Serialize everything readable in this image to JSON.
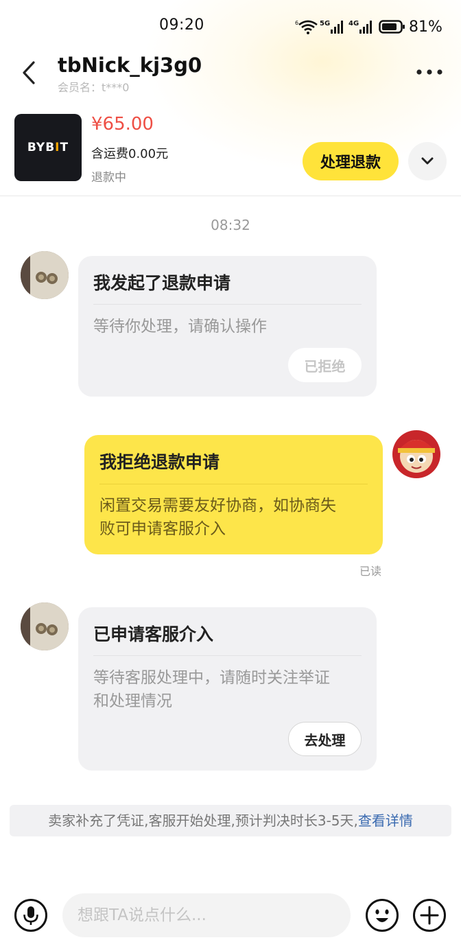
{
  "status_bar": {
    "time": "09:20",
    "battery": "81%",
    "icons": [
      "wifi-icon",
      "signal-5g-icon",
      "signal-4g-icon",
      "battery-icon"
    ]
  },
  "nav": {
    "nickname": "tbNick_kj3g0",
    "member_label": "会员名：t***0"
  },
  "product": {
    "logo_text": "BYB",
    "logo_bar": "I",
    "logo_tail": "T",
    "price": "¥65.00",
    "shipping": "含运费0.00元",
    "status": "退款中",
    "action_label": "处理退款"
  },
  "chat": {
    "timestamp": "08:32",
    "messages": [
      {
        "title": "我发起了退款申请",
        "text": "等待你处理，请确认操作",
        "button": "已拒绝"
      },
      {
        "title": "我拒绝退款申请",
        "text_line1": "闲置交易需要友好协商，如协商失",
        "text_line2": "败可申请客服介入",
        "read": "已读"
      },
      {
        "title": "已申请客服介入",
        "text_line1": "等待客服处理中，请随时关注举证",
        "text_line2": "和处理情况",
        "button": "去处理"
      }
    ],
    "notice": "卖家补充了凭证,客服开始处理,预计判决时长3-5天,",
    "notice_link": "查看详情"
  },
  "input": {
    "placeholder": "想跟TA说点什么..."
  },
  "colors": {
    "accent_yellow": "#ffe33a",
    "price_red": "#ee4f45",
    "link_blue": "#3a6ab0"
  }
}
